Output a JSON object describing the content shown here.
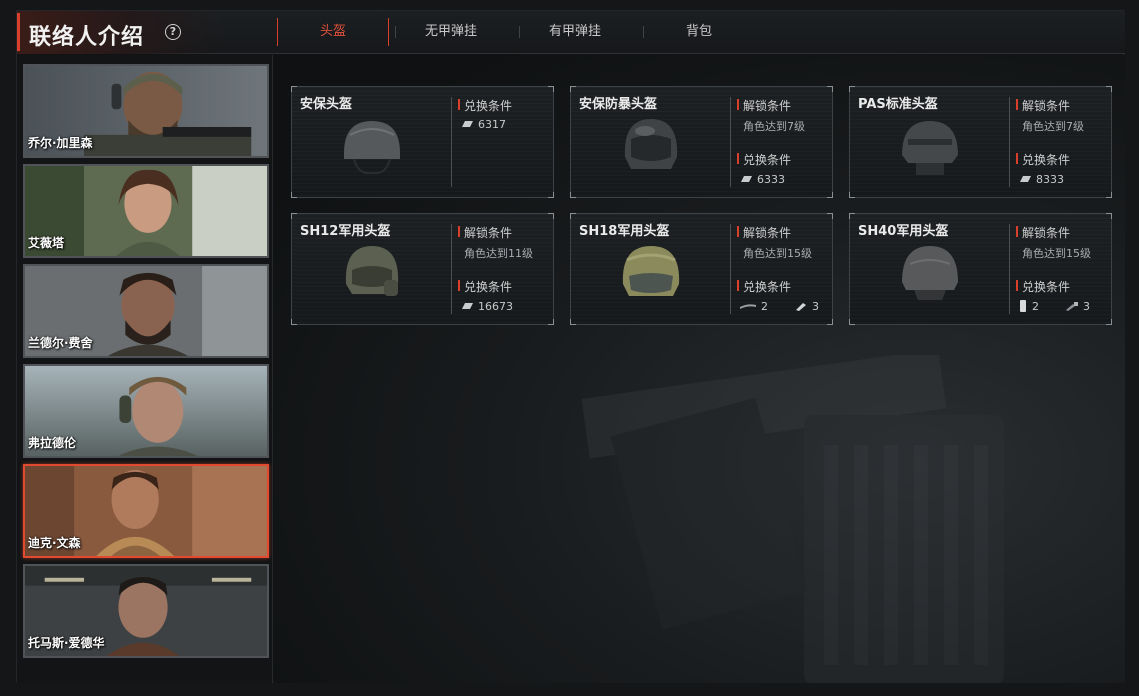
{
  "header": {
    "title": "联络人介绍",
    "help_symbol": "?",
    "tabs": [
      {
        "label": "头盔",
        "active": true
      },
      {
        "label": "无甲弹挂",
        "active": false
      },
      {
        "label": "有甲弹挂",
        "active": false
      },
      {
        "label": "背包",
        "active": false
      }
    ]
  },
  "sidebar": {
    "contacts": [
      {
        "name": "乔尔·加里森",
        "active": false
      },
      {
        "name": "艾薇塔",
        "active": false
      },
      {
        "name": "兰德尔·费舍",
        "active": false
      },
      {
        "name": "弗拉德伦",
        "active": false
      },
      {
        "name": "迪克·文森",
        "active": true
      },
      {
        "name": "托马斯·爱德华",
        "active": false
      }
    ]
  },
  "items": [
    {
      "name": "安保头盔",
      "unlock_label": "",
      "unlock_value": "",
      "exchange_label": "兑换条件",
      "cost": "6317"
    },
    {
      "name": "安保防暴头盔",
      "unlock_label": "解锁条件",
      "unlock_value": "角色达到7级",
      "exchange_label": "兑换条件",
      "cost": "6333"
    },
    {
      "name": "PAS标准头盔",
      "unlock_label": "解锁条件",
      "unlock_value": "角色达到7级",
      "exchange_label": "兑换条件",
      "cost": "8333"
    },
    {
      "name": "SH12军用头盔",
      "unlock_label": "解锁条件",
      "unlock_value": "角色达到11级",
      "exchange_label": "兑换条件",
      "cost": "16673"
    },
    {
      "name": "SH18军用头盔",
      "unlock_label": "解锁条件",
      "unlock_value": "角色达到15级",
      "exchange_label": "兑换条件",
      "cost_a": "2",
      "cost_b": "3"
    },
    {
      "name": "SH40军用头盔",
      "unlock_label": "解锁条件",
      "unlock_value": "角色达到15级",
      "exchange_label": "兑换条件",
      "cost_a": "2",
      "cost_b": "3"
    }
  ],
  "colors": {
    "accent": "#d9402b",
    "active_border": "#e04a2e"
  },
  "icons": {
    "help": "help-circle-icon",
    "currency": "silver-bar-icon"
  }
}
